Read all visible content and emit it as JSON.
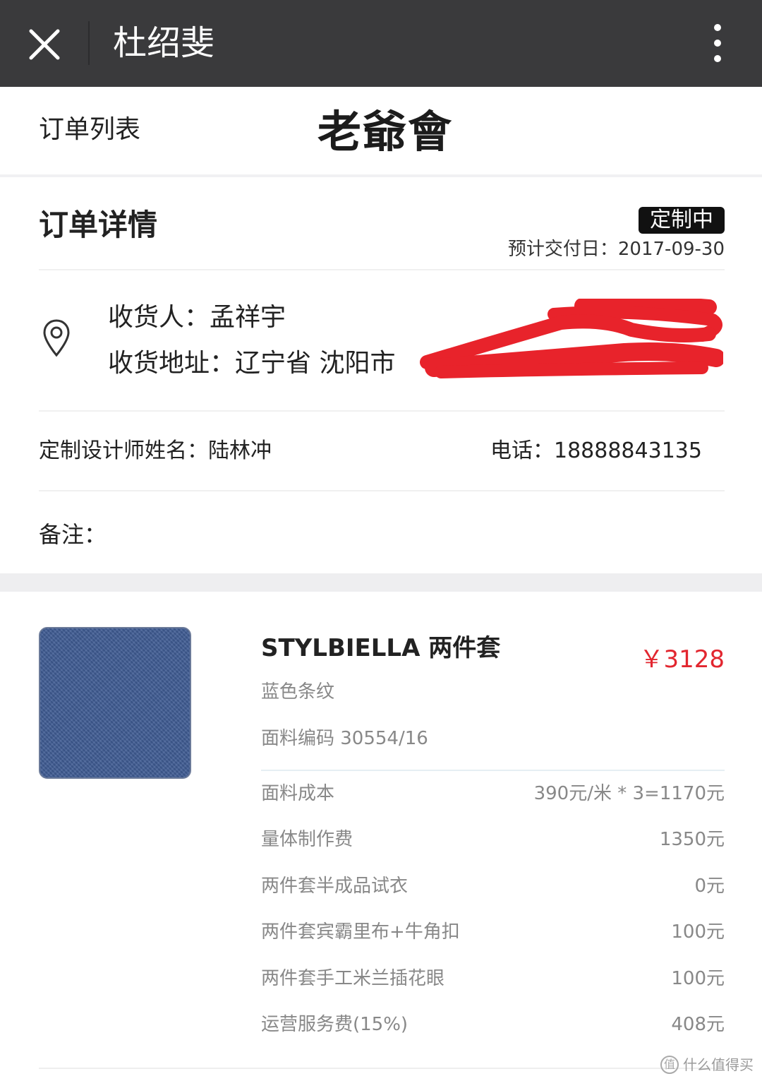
{
  "titlebar": {
    "title": "杜绍斐",
    "close_icon": "close-icon",
    "more_icon": "more-vertical-icon",
    "bg_color": "#3a3a3c"
  },
  "header": {
    "back_link": "订单列表",
    "logo_text": "老爺會"
  },
  "order": {
    "title": "订单详情",
    "status": "定制中",
    "delivery": "预计交付日：2017-09-30"
  },
  "address": {
    "pin_icon": "location-pin-icon",
    "receiver": "收货人：孟祥宇",
    "address": "收货地址：辽宁省 沈阳市",
    "redaction_color": "#e8232b"
  },
  "designer": {
    "name": "定制设计师姓名：陆林冲",
    "phone": "电话：18888843135"
  },
  "remark": {
    "label": "备注："
  },
  "product": {
    "name": "STYLBIELLA 两件套",
    "price": "￥3128",
    "price_color": "#e2262f",
    "desc": "蓝色条纹",
    "code": "面料编码 30554/16",
    "swatch_color": "#3f5c94",
    "costs": [
      {
        "label": "面料成本",
        "value": "390元/米 * 3=1170元"
      },
      {
        "label": "量体制作费",
        "value": "1350元"
      },
      {
        "label": "两件套半成品试衣",
        "value": "0元"
      },
      {
        "label": "两件套宾霸里布+牛角扣",
        "value": "100元"
      },
      {
        "label": "两件套手工米兰插花眼",
        "value": "100元"
      },
      {
        "label": "运营服务费(15%)",
        "value": "408元"
      }
    ]
  },
  "watermark": {
    "text": "什么值得买",
    "icon_glyph": "值"
  }
}
